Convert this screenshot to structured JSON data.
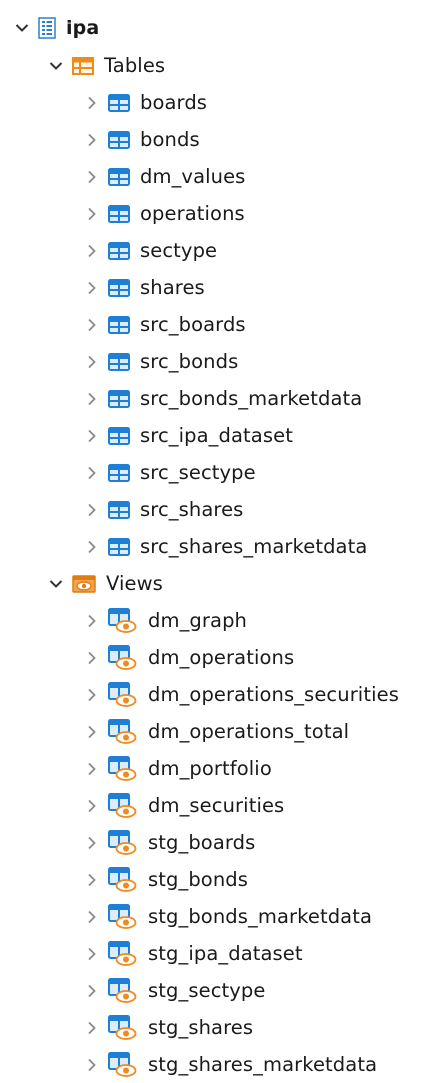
{
  "database": {
    "name": "ipa",
    "icon": "database-icon",
    "expanded": true
  },
  "tables_folder": {
    "label": "Tables",
    "icon": "tables-folder-icon",
    "expanded": true,
    "items": [
      "boards",
      "bonds",
      "dm_values",
      "operations",
      "sectype",
      "shares",
      "src_boards",
      "src_bonds",
      "src_bonds_marketdata",
      "src_ipa_dataset",
      "src_sectype",
      "src_shares",
      "src_shares_marketdata"
    ],
    "item_icon": "table-icon"
  },
  "views_folder": {
    "label": "Views",
    "icon": "views-folder-icon",
    "expanded": true,
    "items": [
      "dm_graph",
      "dm_operations",
      "dm_operations_securities",
      "dm_operations_total",
      "dm_portfolio",
      "dm_securities",
      "stg_boards",
      "stg_bonds",
      "stg_bonds_marketdata",
      "stg_ipa_dataset",
      "stg_sectype",
      "stg_shares",
      "stg_shares_marketdata"
    ],
    "item_icon": "view-icon"
  },
  "colors": {
    "table_blue": "#1f7fd6",
    "folder_orange": "#f08a1c",
    "chevron": "#8a8a8a",
    "chevron_expanded": "#333333"
  }
}
